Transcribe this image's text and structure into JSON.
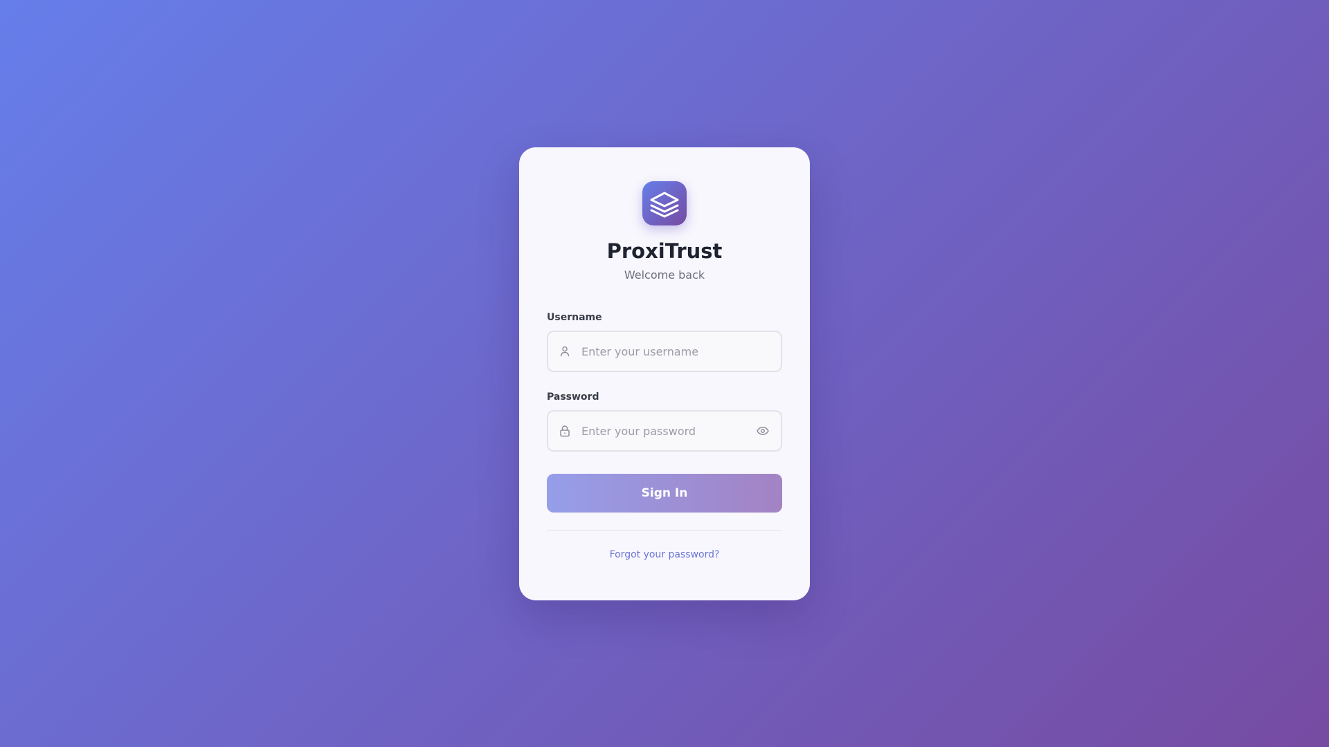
{
  "app": {
    "name": "ProxiTrust",
    "subtitle": "Welcome back",
    "logo_icon": "layers-icon"
  },
  "form": {
    "username": {
      "label": "Username",
      "placeholder": "Enter your username",
      "value": "",
      "icon": "user-icon"
    },
    "password": {
      "label": "Password",
      "placeholder": "Enter your password",
      "value": "",
      "icon": "lock-icon",
      "toggle_icon": "eye-icon"
    },
    "submit_label": "Sign In",
    "forgot_label": "Forgot your password?"
  },
  "colors": {
    "gradient_start": "#667eea",
    "gradient_end": "#764ba2",
    "link": "#6a74d6"
  }
}
